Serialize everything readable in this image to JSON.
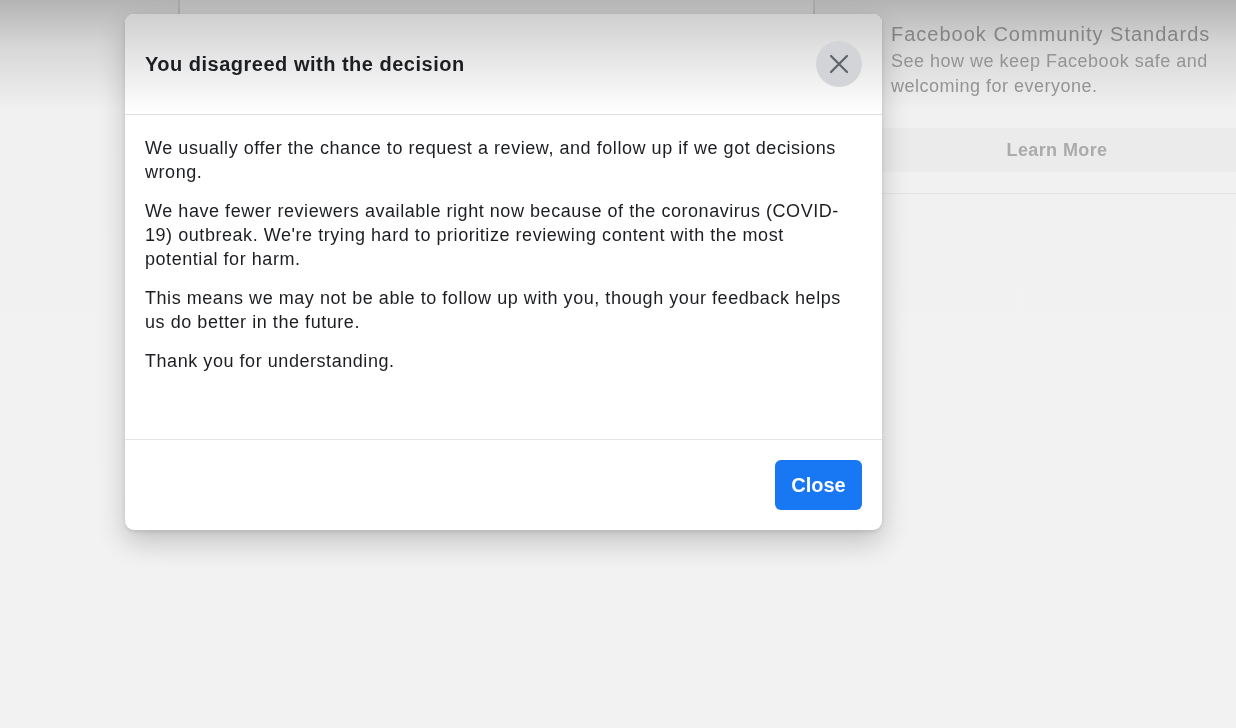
{
  "background_page": {
    "sidebar_card": {
      "title": "Facebook Community Standards",
      "description": "See how we keep Facebook safe and welcoming for everyone.",
      "button": "Learn More"
    }
  },
  "dialog": {
    "title": "You disagreed with the decision",
    "paragraphs": [
      "We usually offer the chance to request a review, and follow up if we got decisions wrong.",
      "We have fewer reviewers available right now because of the coronavirus (COVID-19) outbreak. We're trying hard to prioritize reviewing content with the most potential for harm.",
      "This means we may not be able to follow up with you, though your feedback helps us do better in the future.",
      "Thank you for understanding."
    ],
    "buttons": [
      "Close"
    ]
  }
}
